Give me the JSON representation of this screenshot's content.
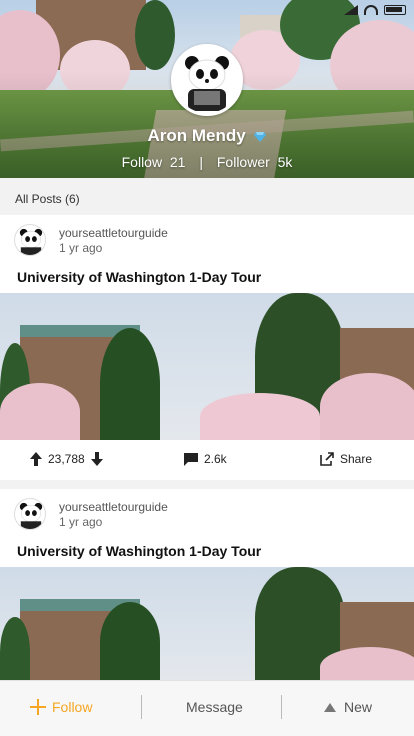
{
  "profile": {
    "name": "Aron Mendy",
    "follow_label": "Follow",
    "follow_count": "21",
    "follower_label": "Follower",
    "follower_count": "5k"
  },
  "posts_header": "All Posts (6)",
  "posts": [
    {
      "user": "yourseattletourguide",
      "time": "1 yr ago",
      "title": "University of Washington 1-Day Tour",
      "votes": "23,788",
      "comments": "2.6k",
      "share_label": "Share"
    },
    {
      "user": "yourseattletourguide",
      "time": "1 yr ago",
      "title": "University of Washington 1-Day Tour"
    }
  ],
  "bottom_bar": {
    "follow_label": "Follow",
    "message_label": "Message",
    "new_label": "New"
  },
  "colors": {
    "accent": "#f5a623",
    "diamond": "#4fb3e8"
  },
  "icons": [
    "panda-avatar-icon",
    "diamond-icon",
    "arrow-up-icon",
    "arrow-down-icon",
    "comment-icon",
    "share-icon",
    "plus-icon",
    "cloud-upload-icon"
  ]
}
